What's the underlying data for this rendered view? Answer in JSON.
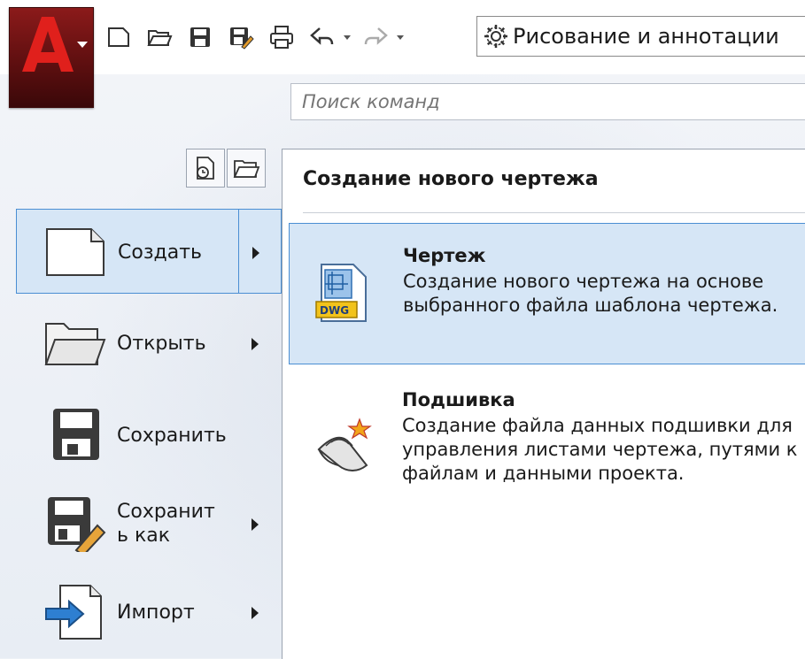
{
  "quick_access": {
    "workspace_label": "Рисование и аннотации",
    "icons": [
      "new-icon",
      "open-icon",
      "save-icon",
      "saveas-icon",
      "print-icon",
      "undo-icon",
      "redo-icon"
    ]
  },
  "search": {
    "placeholder": "Поиск команд"
  },
  "menu": {
    "items": [
      {
        "label": "Создать",
        "has_submenu": true,
        "selected": true
      },
      {
        "label": "Открыть",
        "has_submenu": true,
        "selected": false
      },
      {
        "label": "Сохранить",
        "has_submenu": false,
        "selected": false
      },
      {
        "label": "Сохранит\nь как",
        "has_submenu": true,
        "selected": false
      },
      {
        "label": "Импорт",
        "has_submenu": true,
        "selected": false
      }
    ]
  },
  "panel": {
    "title": "Создание нового чертежа",
    "entries": [
      {
        "title": "Чертеж",
        "desc": "Создание нового чертежа на основе выбранного файла шаблона чертежа.",
        "badge": "DWG"
      },
      {
        "title": "Подшивка",
        "desc": "Создание файла данных подшивки для управления листами чертежа, путями к файлам и данными проекта."
      }
    ]
  },
  "colors": {
    "accent": "#4a8ed3",
    "selection": "#d6e6f6",
    "app_button": "#8b1a1a"
  }
}
